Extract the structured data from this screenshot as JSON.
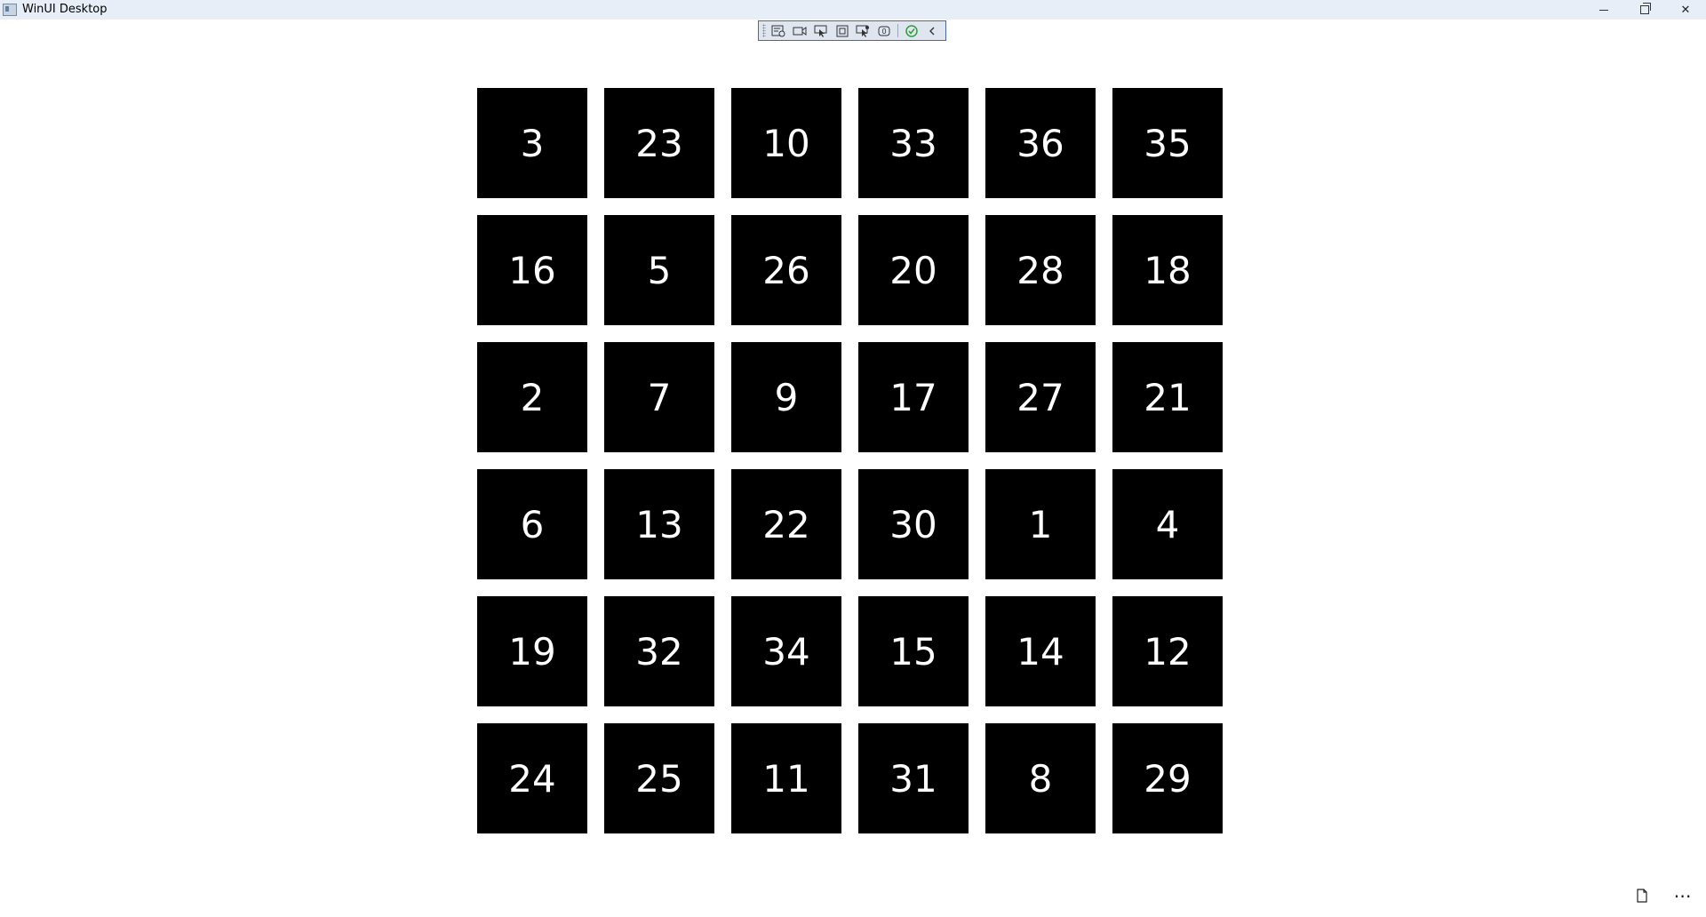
{
  "window": {
    "title": "WinUI Desktop",
    "caption": {
      "minimize_icon": "minimize-icon",
      "maximize_icon": "restore-icon",
      "close_label": "✕"
    }
  },
  "devbar": {
    "icons": [
      "live-visual-tree-icon",
      "record-icon",
      "select-element-icon",
      "display-layout-adorners-icon",
      "track-focus-icon",
      "binding-failures-icon",
      "hot-reload-status-icon",
      "collapse-icon"
    ]
  },
  "grid": {
    "tiles": [
      "3",
      "23",
      "10",
      "33",
      "36",
      "35",
      "16",
      "5",
      "26",
      "20",
      "28",
      "18",
      "2",
      "7",
      "9",
      "17",
      "27",
      "21",
      "6",
      "13",
      "22",
      "30",
      "1",
      "4",
      "19",
      "32",
      "34",
      "15",
      "14",
      "12",
      "24",
      "25",
      "11",
      "31",
      "8",
      "29"
    ]
  },
  "bottom_bar": {
    "more_label": "⋯",
    "page_icon": "page-icon"
  },
  "colors": {
    "tile_bg": "#000000",
    "tile_fg": "#ffffff",
    "titlebar_bg": "#e8eef7",
    "hot_reload_ok": "#2e9e3a"
  }
}
